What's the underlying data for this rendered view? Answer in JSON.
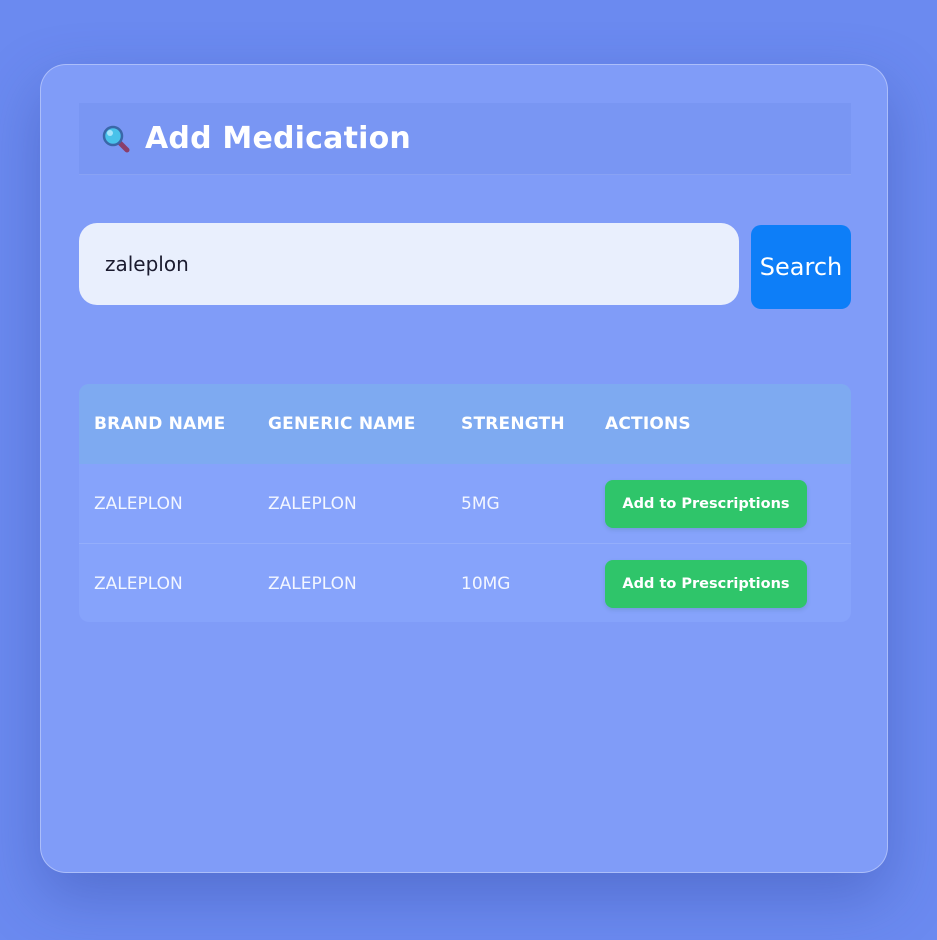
{
  "header": {
    "title": "Add Medication",
    "icon": "search-icon"
  },
  "search": {
    "value": "zaleplon",
    "button_label": "Search"
  },
  "table": {
    "headers": [
      "BRAND NAME",
      "GENERIC NAME",
      "STRENGTH",
      "ACTIONS"
    ],
    "rows": [
      {
        "brand": "ZALEPLON",
        "generic": "ZALEPLON",
        "strength": "5MG",
        "action_label": "Add to Prescriptions"
      },
      {
        "brand": "ZALEPLON",
        "generic": "ZALEPLON",
        "strength": "10MG",
        "action_label": "Add to Prescriptions"
      }
    ]
  },
  "colors": {
    "page_background": "#6b8af0",
    "card_background": "#809cf8",
    "search_button": "#0d7ef8",
    "add_button": "#2fc56a",
    "table_header": "#7eaaf1"
  }
}
